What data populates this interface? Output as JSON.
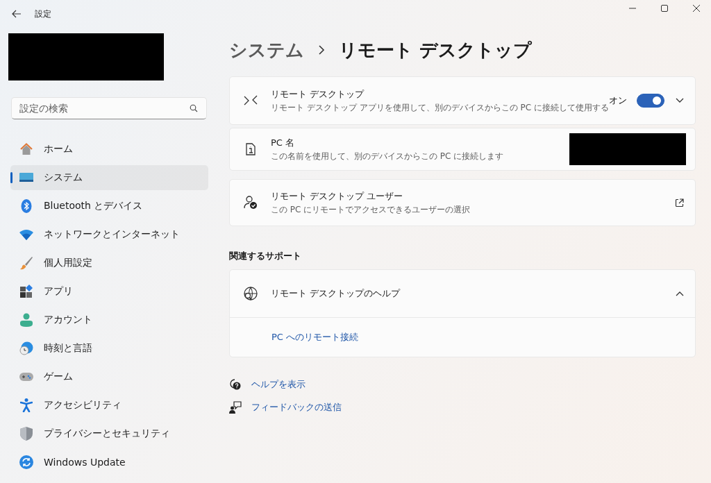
{
  "window": {
    "title": "設定"
  },
  "search": {
    "placeholder": "設定の検索"
  },
  "sidebar": {
    "items": [
      {
        "label": "ホーム",
        "selected": false
      },
      {
        "label": "システム",
        "selected": true
      },
      {
        "label": "Bluetooth とデバイス",
        "selected": false
      },
      {
        "label": "ネットワークとインターネット",
        "selected": false
      },
      {
        "label": "個人用設定",
        "selected": false
      },
      {
        "label": "アプリ",
        "selected": false
      },
      {
        "label": "アカウント",
        "selected": false
      },
      {
        "label": "時刻と言語",
        "selected": false
      },
      {
        "label": "ゲーム",
        "selected": false
      },
      {
        "label": "アクセシビリティ",
        "selected": false
      },
      {
        "label": "プライバシーとセキュリティ",
        "selected": false
      },
      {
        "label": "Windows Update",
        "selected": false
      }
    ]
  },
  "breadcrumb": [
    "システム",
    "リモート デスクトップ"
  ],
  "settings": [
    {
      "kind": "toggle",
      "title": "リモート デスクトップ",
      "description": "リモート デスクトップ アプリを使用して、別のデバイスからこの PC に接続して使用する",
      "state_label": "オン",
      "on": true
    },
    {
      "kind": "value",
      "title": "PC 名",
      "description": "この名前を使用して、別のデバイスからこの PC に接続します"
    },
    {
      "kind": "link",
      "title": "リモート デスクトップ ユーザー",
      "description": "この PC にリモートでアクセスできるユーザーの選択"
    }
  ],
  "related": {
    "heading": "関連するサポート",
    "title": "リモート デスクトップのヘルプ",
    "expanded": true,
    "links": [
      "PC へのリモート接続"
    ]
  },
  "footer_links": [
    {
      "kind": "help",
      "label": "ヘルプを表示"
    },
    {
      "kind": "feedback",
      "label": "フィードバックの送信"
    }
  ]
}
